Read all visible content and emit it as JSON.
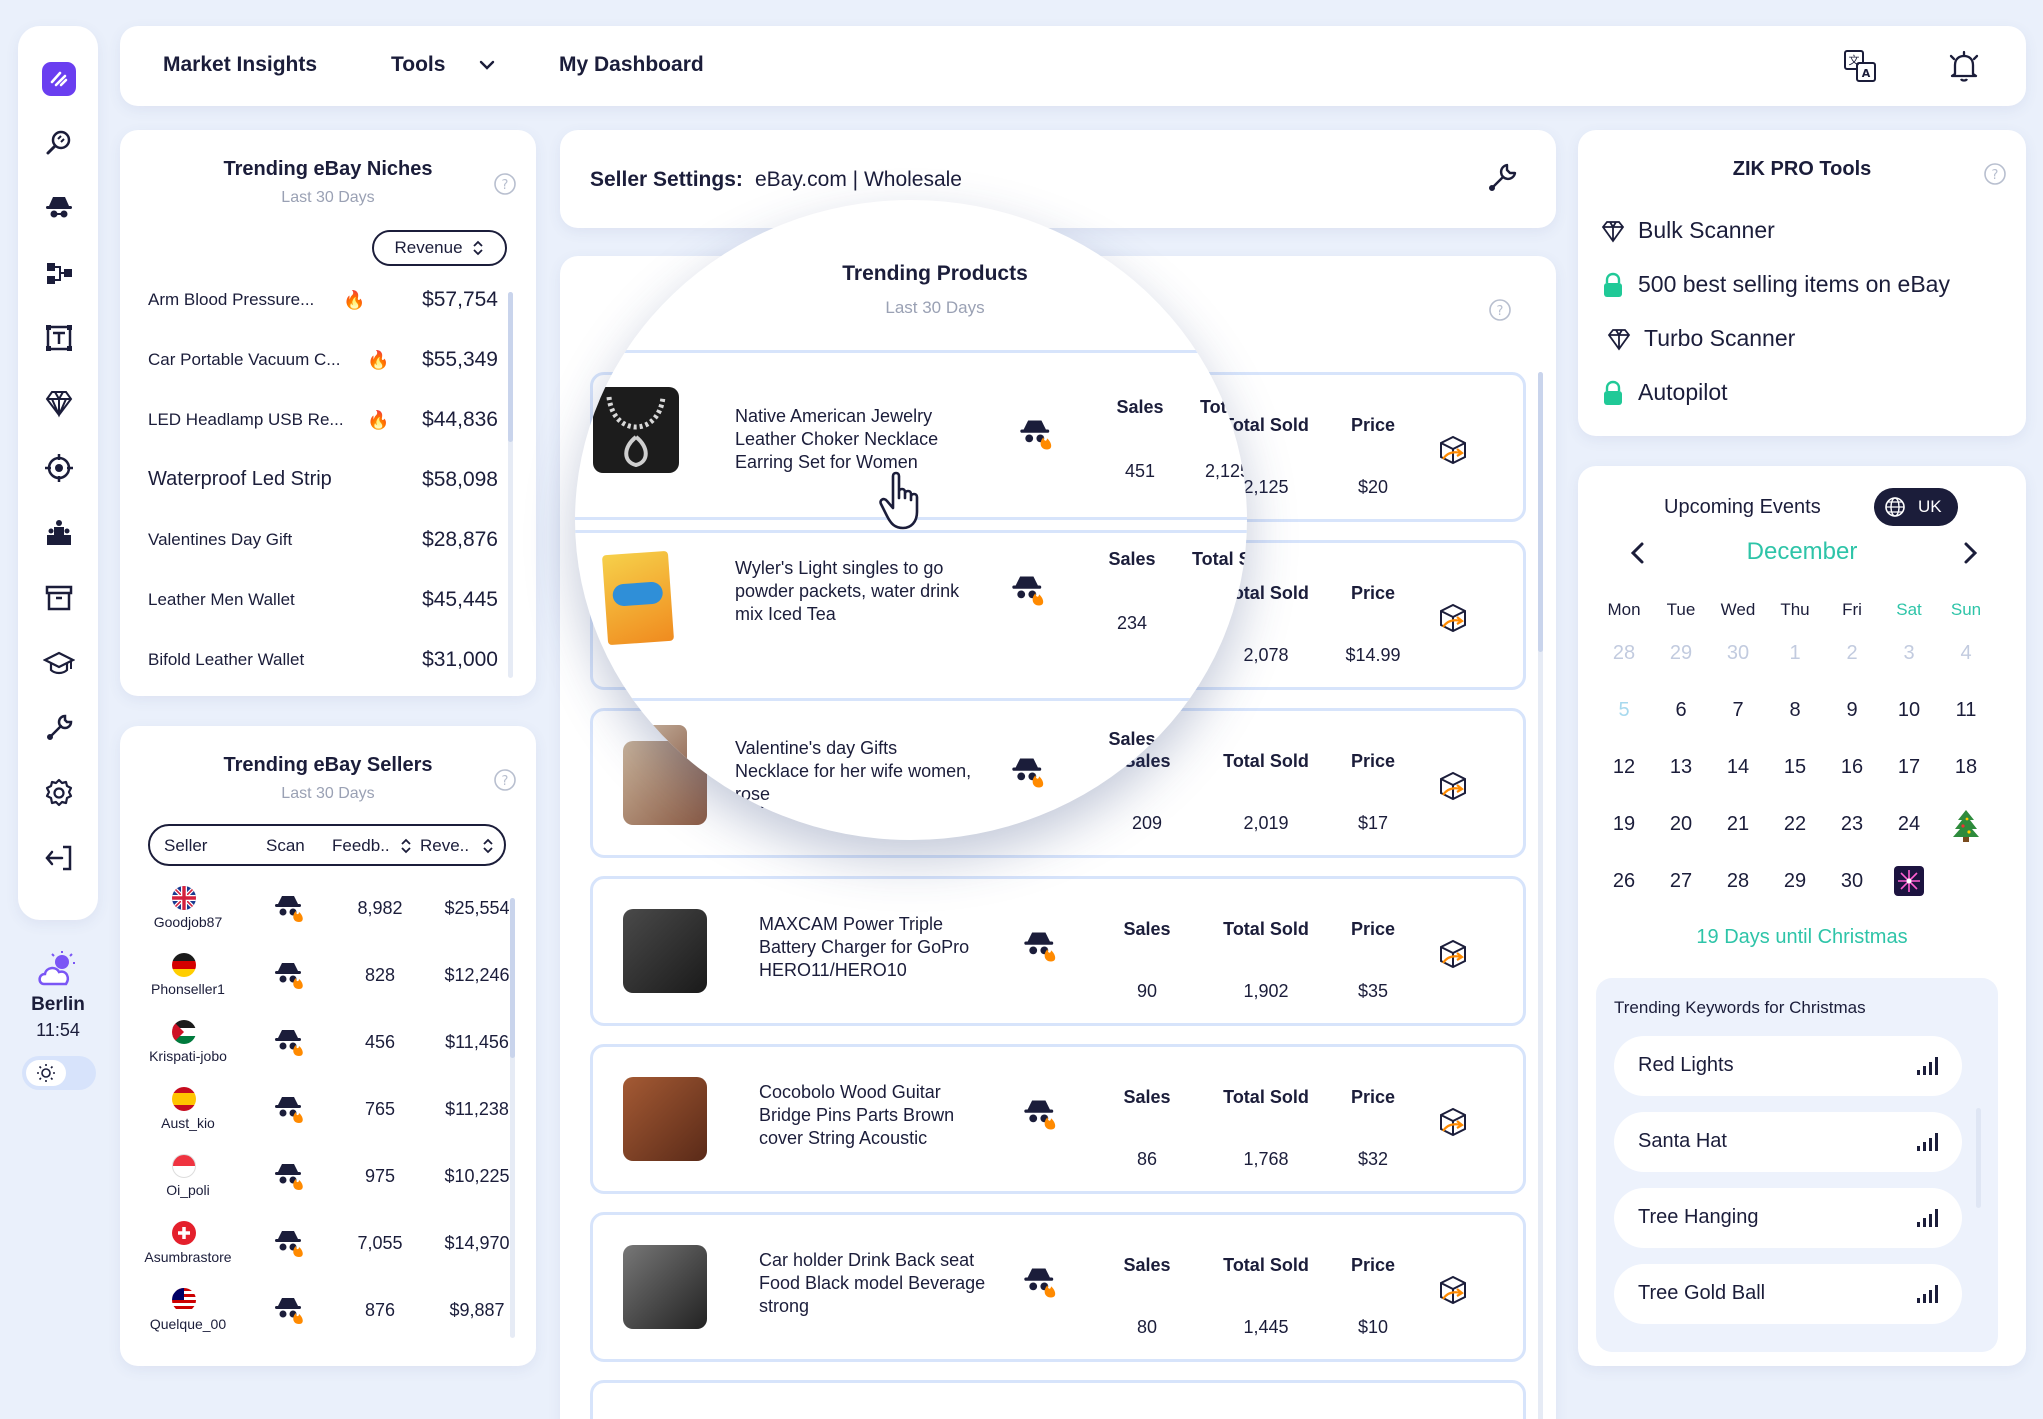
{
  "nav": {
    "items": [
      "Market Insights",
      "Tools",
      "My Dashboard"
    ],
    "tools_dropdown_icon": "chevron-down-icon",
    "icons": [
      "translate-icon",
      "bell-icon"
    ]
  },
  "sidebar": {
    "icons": [
      "logo-icon",
      "search-icon",
      "spy-icon",
      "hierarchy-icon",
      "title-builder-icon",
      "diamond-icon",
      "target-icon",
      "competitor-icon",
      "archive-icon",
      "academy-icon",
      "tools-icon",
      "settings-icon",
      "logout-icon"
    ],
    "weather": {
      "city": "Berlin",
      "time": "11:54",
      "icon": "cloud-sun-icon"
    },
    "theme_icon": "sun-icon"
  },
  "niches": {
    "title": "Trending eBay Niches",
    "subtitle": "Last 30 Days",
    "sort_label": "Revenue",
    "rows": [
      {
        "name": "Arm Blood Pressure...",
        "value": "$57,754",
        "hot": true
      },
      {
        "name": "Car Portable Vacuum C...",
        "value": "$55,349",
        "hot": true
      },
      {
        "name": "LED Headlamp USB Re...",
        "value": "$44,836",
        "hot": true
      },
      {
        "name": "Waterproof Led Strip",
        "value": "$58,098",
        "hot": false
      },
      {
        "name": "Valentines Day Gift",
        "value": "$28,876",
        "hot": false
      },
      {
        "name": "Leather Men Wallet",
        "value": "$45,445",
        "hot": false
      },
      {
        "name": "Bifold Leather Wallet",
        "value": "$31,000",
        "hot": false
      }
    ]
  },
  "sellers": {
    "title": "Trending eBay Sellers",
    "subtitle": "Last 30 Days",
    "columns": [
      "Seller",
      "Scan",
      "Feedb..",
      "Reve.."
    ],
    "rows": [
      {
        "name": "Goodjob87",
        "feedback": "8,982",
        "revenue": "$25,554",
        "flag": "uk"
      },
      {
        "name": "Phonseller1",
        "feedback": "828",
        "revenue": "$12,246",
        "flag": "de"
      },
      {
        "name": "Krispati-jobo",
        "feedback": "456",
        "revenue": "$11,456",
        "flag": "jo"
      },
      {
        "name": "Aust_kio",
        "feedback": "765",
        "revenue": "$11,238",
        "flag": "es"
      },
      {
        "name": "Oi_poli",
        "feedback": "975",
        "revenue": "$10,225",
        "flag": "sg"
      },
      {
        "name": "Asumbrastore",
        "feedback": "7,055",
        "revenue": "$14,970",
        "flag": "ch"
      },
      {
        "name": "Quelque_00",
        "feedback": "876",
        "revenue": "$9,887",
        "flag": "my"
      }
    ]
  },
  "seller_settings": {
    "label": "Seller Settings:",
    "value": "eBay.com | Wholesale",
    "icon": "wrench-icon"
  },
  "products": {
    "title": "Trending Products",
    "subtitle": "Last 30 Days",
    "col_sales": "Sales",
    "col_total": "Total Sold",
    "col_price": "Price",
    "rows": [
      {
        "name": "Native American Jewelry Leather Choker Necklace Earring Set for Women",
        "sales": "451",
        "total": "2,125",
        "price": "$20"
      },
      {
        "name": "Wyler's Light singles to go powder packets, water drink mix Iced Tea",
        "sales": "234",
        "total": "2,078",
        "price": "$14.99"
      },
      {
        "name": "Valentine's day Gifts Necklace for her wife women, rose",
        "sales": "209",
        "total": "2,019",
        "price": "$17"
      },
      {
        "name": "MAXCAM Power Triple Battery Charger for GoPro HERO11/HERO10",
        "sales": "90",
        "total": "1,902",
        "price": "$35"
      },
      {
        "name": "Cocobolo Wood Guitar Bridge Pins Parts Brown cover String Acoustic",
        "sales": "86",
        "total": "1,768",
        "price": "$32"
      },
      {
        "name": "Car holder Drink Back seat Food Black model Beverage strong",
        "sales": "80",
        "total": "1,445",
        "price": "$10"
      }
    ]
  },
  "zik_tools": {
    "title": "ZIK PRO Tools",
    "items": [
      {
        "label": "Bulk Scanner",
        "icon": "diamond-icon"
      },
      {
        "label": "500 best selling items on eBay",
        "icon": "lock-icon"
      },
      {
        "label": "Turbo Scanner",
        "icon": "diamond-icon"
      },
      {
        "label": "Autopilot",
        "icon": "lock-icon"
      }
    ]
  },
  "events": {
    "title": "Upcoming Events",
    "region": "UK",
    "month": "December",
    "weekdays": [
      "Mon",
      "Tue",
      "Wed",
      "Thu",
      "Fri",
      "Sat",
      "Sun"
    ],
    "weeks": [
      [
        "28",
        "29",
        "30",
        "1",
        "2",
        "3",
        "4"
      ],
      [
        "5",
        "6",
        "7",
        "8",
        "9",
        "10",
        "11"
      ],
      [
        "12",
        "13",
        "14",
        "15",
        "16",
        "17",
        "18"
      ],
      [
        "19",
        "20",
        "21",
        "22",
        "23",
        "24",
        ""
      ],
      [
        "26",
        "27",
        "28",
        "29",
        "30",
        "",
        ""
      ]
    ],
    "countdown": "19 Days until Christmas",
    "accent": "#2ec4a8"
  },
  "keywords": {
    "title": "Trending Keywords for Christmas",
    "items": [
      "Red Lights",
      "Santa Hat",
      "Tree Hanging",
      "Tree Gold Ball"
    ]
  }
}
